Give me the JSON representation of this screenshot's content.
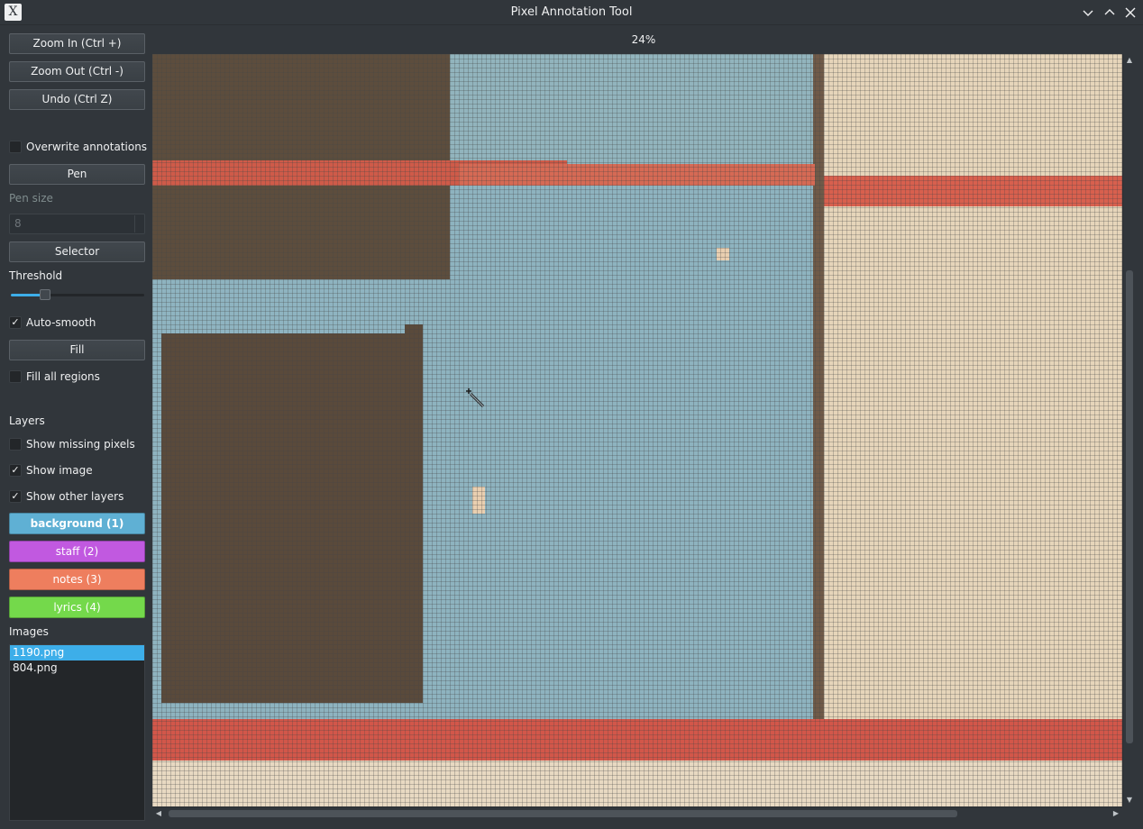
{
  "window": {
    "title": "Pixel Annotation Tool",
    "app_icon": "x-icon"
  },
  "toolbar": {
    "zoom_in": "Zoom In (Ctrl +)",
    "zoom_out": "Zoom Out (Ctrl -)",
    "undo": "Undo (Ctrl Z)",
    "overwrite_annotations": "Overwrite annotations",
    "overwrite_checked": false,
    "pen": "Pen",
    "pen_size_label": "Pen size",
    "pen_size_value": "8",
    "selector": "Selector",
    "threshold_label": "Threshold",
    "threshold_fraction": 0.26,
    "auto_smooth": "Auto-smooth",
    "auto_smooth_checked": true,
    "fill": "Fill",
    "fill_all_regions": "Fill all regions",
    "fill_all_checked": false
  },
  "layers": {
    "heading": "Layers",
    "show_missing_pixels": "Show missing pixels",
    "show_missing_checked": false,
    "show_image": "Show image",
    "show_image_checked": true,
    "show_other_layers": "Show other layers",
    "show_other_checked": true,
    "items": [
      {
        "label": "background (1)",
        "color": "#5fb0d4",
        "active": true
      },
      {
        "label": "staff (2)",
        "color": "#c159e0",
        "active": false
      },
      {
        "label": "notes (3)",
        "color": "#ee7e5e",
        "active": false
      },
      {
        "label": "lyrics (4)",
        "color": "#74d94b",
        "active": false
      }
    ]
  },
  "images": {
    "heading": "Images",
    "files": [
      {
        "name": "1190.png",
        "selected": true
      },
      {
        "name": "804.png",
        "selected": false
      }
    ]
  },
  "canvas": {
    "zoom": "24%",
    "colors": {
      "background_layer": "#8fb3c0",
      "notes_layer": "#d55a48",
      "paper": "#eadbc3",
      "dark_image": "#5a4a3a"
    }
  }
}
